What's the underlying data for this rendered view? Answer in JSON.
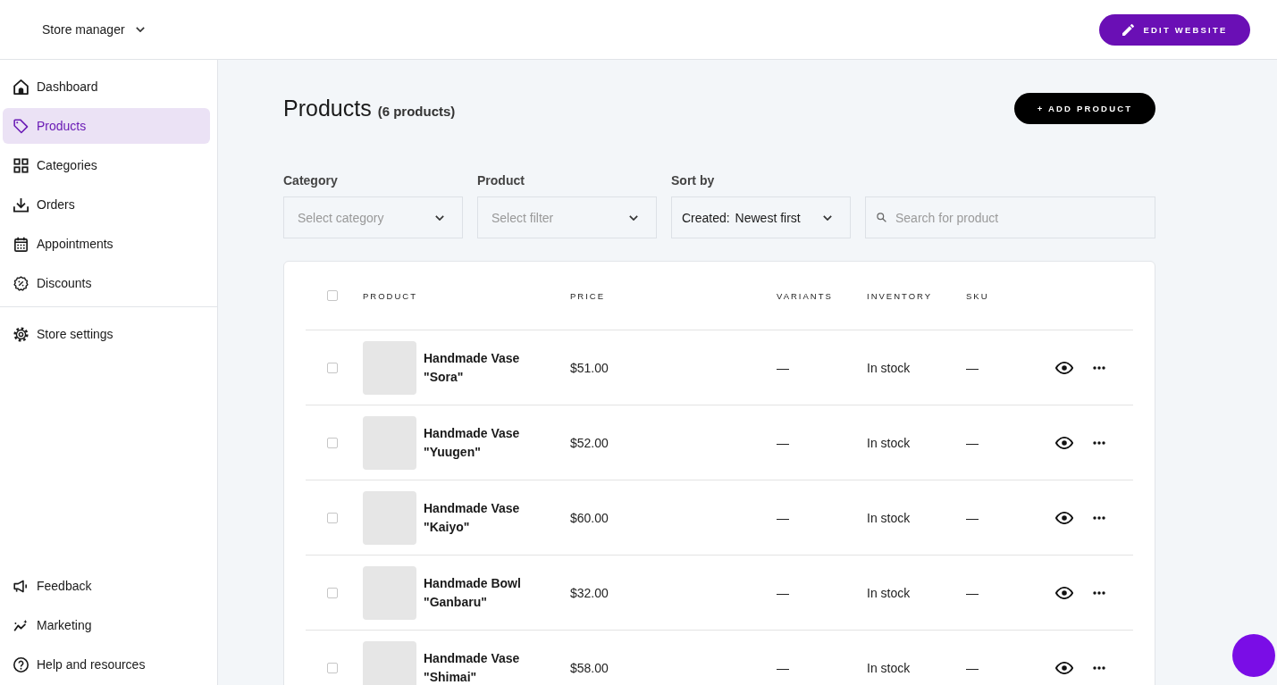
{
  "top_bar": {
    "store_switcher": "Store manager",
    "edit_button": "EDIT WEBSITE"
  },
  "sidebar": {
    "sections": [
      {
        "items": [
          {
            "label": "Dashboard",
            "selected": false
          },
          {
            "label": "Products",
            "selected": true
          },
          {
            "label": "Categories",
            "selected": false
          },
          {
            "label": "Orders",
            "selected": false
          },
          {
            "label": "Appointments",
            "selected": false
          },
          {
            "label": "Discounts",
            "selected": false
          }
        ]
      },
      {
        "items": [
          {
            "label": "Store settings",
            "selected": false
          }
        ]
      },
      {
        "items": [
          {
            "label": "Feedback",
            "selected": false
          },
          {
            "label": "Marketing",
            "selected": false
          },
          {
            "label": "Help and resources",
            "selected": false
          }
        ]
      }
    ]
  },
  "page": {
    "title": "Products",
    "count": "(6 products)",
    "add_button": "+ ADD PRODUCT"
  },
  "filters": {
    "category": {
      "label": "Category",
      "placeholder": "Select category"
    },
    "product": {
      "label": "Product",
      "placeholder": "Select filter"
    },
    "sort": {
      "label": "Sort by",
      "prefix": "Created:",
      "value": "Newest first"
    },
    "search": {
      "placeholder": "Search for product"
    }
  },
  "table": {
    "all_checked": false,
    "columns": [
      "PRODUCT",
      "PRICE",
      "VARIANTS",
      "INVENTORY",
      "SKU"
    ],
    "rows": [
      {
        "selected": false,
        "name": "Handmade Vase \"Sora\"",
        "price": "$51.00",
        "variants": "—",
        "inventory": "In stock",
        "sku": "—"
      },
      {
        "selected": false,
        "name": "Handmade Vase \"Yuugen\"",
        "price": "$52.00",
        "variants": "—",
        "inventory": "In stock",
        "sku": "—"
      },
      {
        "selected": false,
        "name": "Handmade Vase \"Kaiyo\"",
        "price": "$60.00",
        "variants": "—",
        "inventory": "In stock",
        "sku": "—"
      },
      {
        "selected": false,
        "name": "Handmade Bowl \"Ganbaru\"",
        "price": "$32.00",
        "variants": "—",
        "inventory": "In stock",
        "sku": "—"
      },
      {
        "selected": false,
        "name": "Handmade Vase \"Shimai\"",
        "price": "$58.00",
        "variants": "—",
        "inventory": "In stock",
        "sku": "—"
      }
    ]
  }
}
